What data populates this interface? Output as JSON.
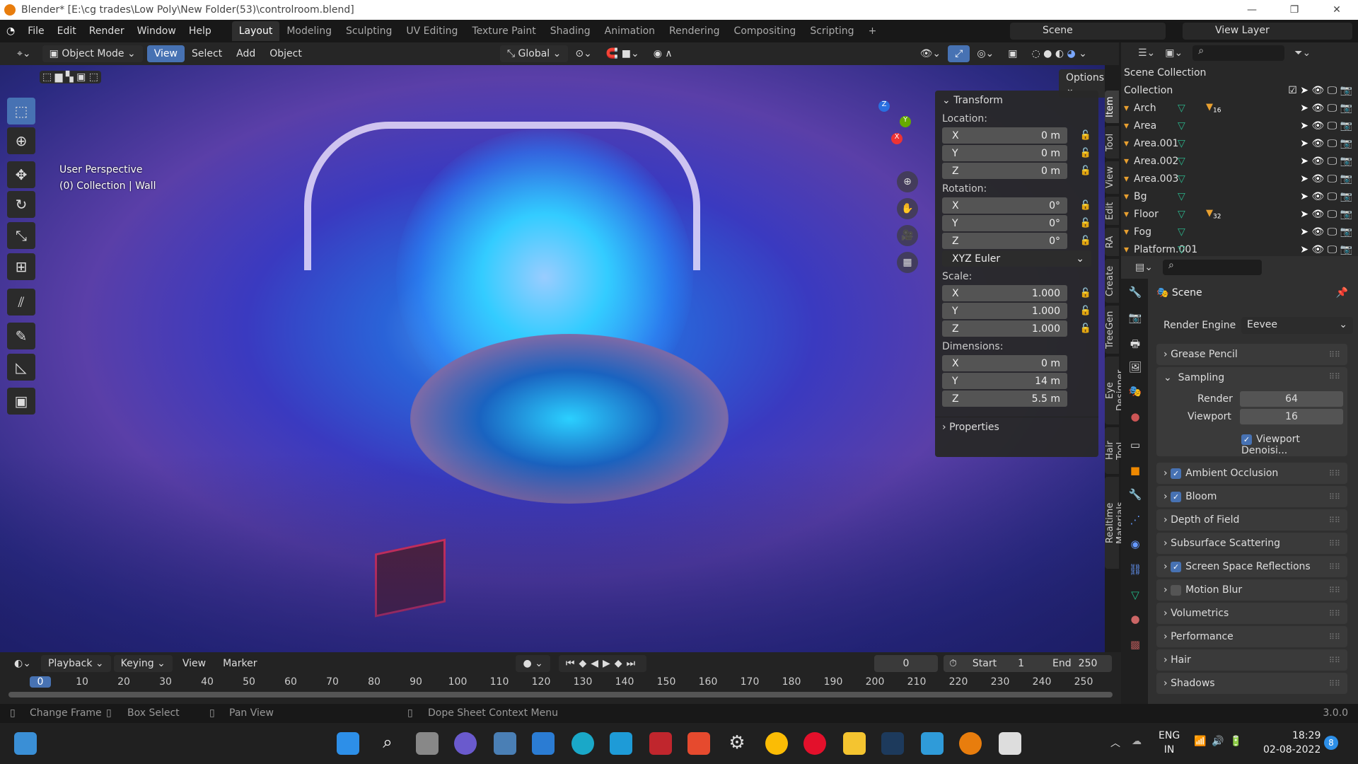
{
  "title": "Blender* [E:\\cg trades\\Low Poly\\New Folder(53)\\controlroom.blend]",
  "menu": [
    "File",
    "Edit",
    "Render",
    "Window",
    "Help"
  ],
  "workspaces": [
    "Layout",
    "Modeling",
    "Sculpting",
    "UV Editing",
    "Texture Paint",
    "Shading",
    "Animation",
    "Rendering",
    "Compositing",
    "Scripting",
    "+"
  ],
  "scene": "Scene",
  "view_layer": "View Layer",
  "header": {
    "mode": "Object Mode",
    "view": "View",
    "select": "Select",
    "add": "Add",
    "object": "Object",
    "orientation": "Global",
    "options": "Options"
  },
  "viewport": {
    "perspective": "User Perspective",
    "collection": "(0) Collection | Wall"
  },
  "npanel": {
    "transform": "Transform",
    "location": "Location:",
    "rotation": "Rotation:",
    "scale": "Scale:",
    "dimensions": "Dimensions:",
    "euler": "XYZ Euler",
    "properties": "Properties",
    "loc": [
      [
        "X",
        "0 m"
      ],
      [
        "Y",
        "0 m"
      ],
      [
        "Z",
        "0 m"
      ]
    ],
    "rot": [
      [
        "X",
        "0°"
      ],
      [
        "Y",
        "0°"
      ],
      [
        "Z",
        "0°"
      ]
    ],
    "scl": [
      [
        "X",
        "1.000"
      ],
      [
        "Y",
        "1.000"
      ],
      [
        "Z",
        "1.000"
      ]
    ],
    "dim": [
      [
        "X",
        "0 m"
      ],
      [
        "Y",
        "14 m"
      ],
      [
        "Z",
        "5.5 m"
      ]
    ]
  },
  "side_tabs": [
    "Item",
    "Tool",
    "View",
    "Edit",
    "RA",
    "Create",
    "TreeGen",
    "Eye Designer",
    "Hair Tool",
    "Realtime Materials"
  ],
  "outliner": {
    "root": "Scene Collection",
    "collection": "Collection",
    "items": [
      {
        "name": "Arch",
        "badge": "16"
      },
      {
        "name": "Area"
      },
      {
        "name": "Area.001"
      },
      {
        "name": "Area.002"
      },
      {
        "name": "Area.003"
      },
      {
        "name": "Bg"
      },
      {
        "name": "Floor",
        "badge": "32"
      },
      {
        "name": "Fog"
      },
      {
        "name": "Platform.001"
      }
    ]
  },
  "properties": {
    "scene": "Scene",
    "render_engine_label": "Render Engine",
    "render_engine": "Eevee",
    "grease_pencil": "Grease Pencil",
    "sampling": "Sampling",
    "render_label": "Render",
    "render": "64",
    "viewport_label": "Viewport",
    "viewport": "16",
    "viewport_denoise": "Viewport Denoisi...",
    "panels": [
      {
        "label": "Ambient Occlusion",
        "check": true
      },
      {
        "label": "Bloom",
        "check": true
      },
      {
        "label": "Depth of Field"
      },
      {
        "label": "Subsurface Scattering"
      },
      {
        "label": "Screen Space Reflections",
        "check": true
      },
      {
        "label": "Motion Blur",
        "check": false
      },
      {
        "label": "Volumetrics"
      },
      {
        "label": "Performance"
      },
      {
        "label": "Hair"
      },
      {
        "label": "Shadows"
      }
    ]
  },
  "timeline": {
    "playback": "Playback",
    "keying": "Keying",
    "view": "View",
    "marker": "Marker",
    "current": "0",
    "start_label": "Start",
    "start": "1",
    "end_label": "End",
    "end": "250",
    "ticks": [
      "0",
      "10",
      "20",
      "30",
      "40",
      "50",
      "60",
      "70",
      "80",
      "90",
      "100",
      "110",
      "120",
      "130",
      "140",
      "150",
      "160",
      "170",
      "180",
      "190",
      "200",
      "210",
      "220",
      "230",
      "240",
      "250"
    ]
  },
  "status": {
    "change_frame": "Change Frame",
    "box_select": "Box Select",
    "pan_view": "Pan View",
    "context": "Dope Sheet Context Menu",
    "version": "3.0.0"
  },
  "taskbar": {
    "lang1": "ENG",
    "lang2": "IN",
    "time": "18:29",
    "date": "02-08-2022",
    "notif": "8"
  }
}
